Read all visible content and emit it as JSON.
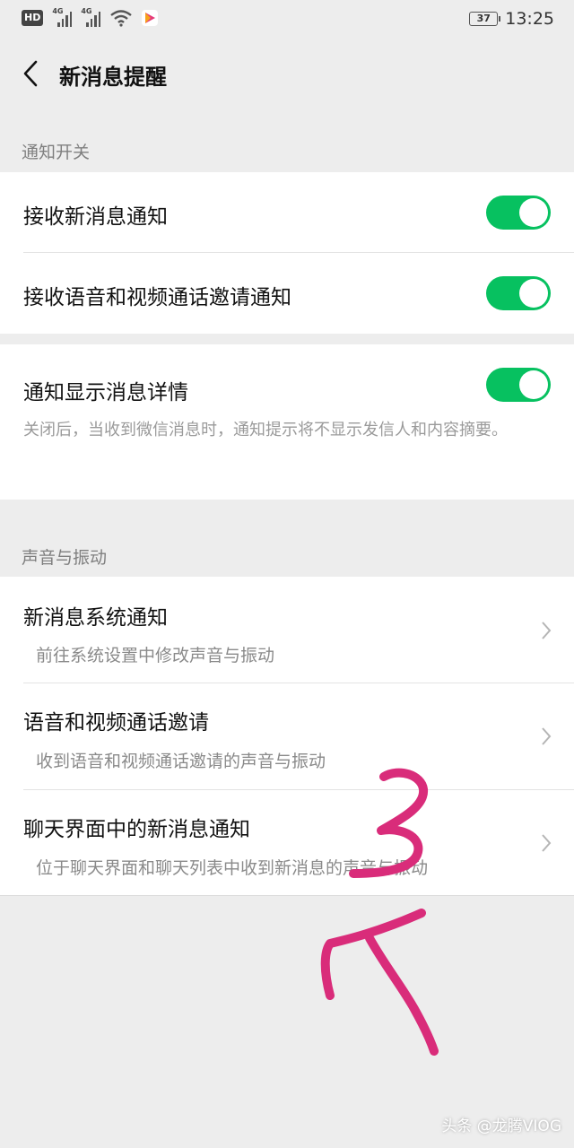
{
  "status_bar": {
    "hd": "HD",
    "net1": "4G",
    "net2": "4G",
    "battery": "37",
    "time": "13:25"
  },
  "nav": {
    "title": "新消息提醒"
  },
  "sections": {
    "notify": {
      "label": "通知开关",
      "items": [
        {
          "title": "接收新消息通知",
          "toggle": "on"
        },
        {
          "title": "接收语音和视频通话邀请通知",
          "toggle": "on"
        }
      ]
    },
    "detail": {
      "title": "通知显示消息详情",
      "toggle": "on",
      "description": "关闭后，当收到微信消息时，通知提示将不显示发信人和内容摘要。"
    },
    "sound": {
      "label": "声音与振动",
      "items": [
        {
          "title": "新消息系统通知",
          "subtitle": "前往系统设置中修改声音与振动"
        },
        {
          "title": "语音和视频通话邀请",
          "subtitle": "收到语音和视频通话邀请的声音与振动"
        },
        {
          "title": "聊天界面中的新消息通知",
          "subtitle": "位于聊天界面和聊天列表中收到新消息的声音与振动"
        }
      ]
    }
  },
  "colors": {
    "toggle_on": "#07c160",
    "annotation": "#d92c7a",
    "background": "#ededed"
  },
  "watermark": "头条 @龙腾VIOG"
}
